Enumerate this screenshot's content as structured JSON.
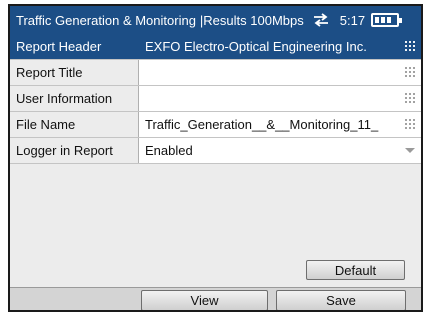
{
  "titlebar": {
    "app": "Traffic Generation  & Monitoring",
    "context": "|Results 100Mbps",
    "transfer_icon": "transfer-arrows-icon",
    "time": "5:17",
    "battery_icon": "battery-icon"
  },
  "rows": [
    {
      "label": "Report Header",
      "value": "EXFO Electro-Optical Engineering Inc.",
      "selected": true
    },
    {
      "label": "Report Title",
      "value": ""
    },
    {
      "label": "User Information",
      "value": ""
    },
    {
      "label": "File Name",
      "value": "Traffic_Generation__&__Monitoring_11_"
    },
    {
      "label": "Logger in Report",
      "value": "Enabled"
    }
  ],
  "buttons": {
    "default": "Default",
    "view": "View",
    "save": "Save"
  },
  "colors": {
    "accent": "#1c4e86",
    "panel": "#ececec"
  }
}
